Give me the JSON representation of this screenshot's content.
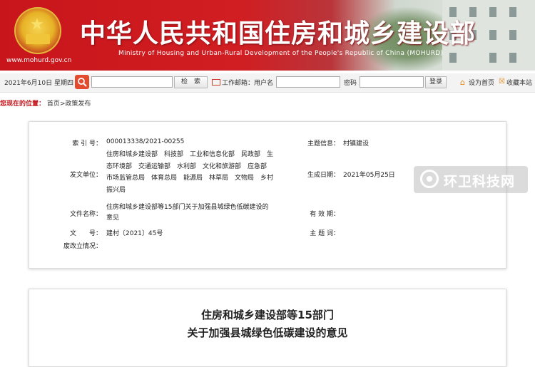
{
  "banner": {
    "title": "中华人民共和国住房和城乡建设部",
    "subtitle": "Ministry of Housing and Urban-Rural Development of the People's Republic of China (MOHURD)",
    "url": "www.mohurd.gov.cn"
  },
  "toolbar": {
    "date": "2021年6月10日 星期四",
    "search_button": "检　索",
    "mail_label": "工作邮箱：用户名",
    "password_label": "密码",
    "login_button": "登录",
    "set_home": "设为首页",
    "add_favorite": "收藏本站",
    "search_value": "",
    "username_value": "",
    "password_value": ""
  },
  "breadcrumb": {
    "location_label": "您现在的位置：",
    "path": "首页>政策发布"
  },
  "info": {
    "index_label": "索 引 号：",
    "index_value": "000013338/2021-00255",
    "topic_label": "主题信息：",
    "topic_value": "村镇建设",
    "issuer_label": "发文单位：",
    "issuer_value": "住房和城乡建设部　科技部　工业和信息化部　民政部　生态环境部　交通运输部　水利部　文化和旅游部　应急部　市场监管总局　体育总局　能源局　林草局　文物局　乡村振兴局",
    "date_label": "生成日期：",
    "date_value": "2021年05月25日",
    "docname_label": "文件名称：",
    "docname_value": "住房和城乡建设部等15部门关于加强县城绿色低碳建设的意见",
    "validity_label": "有 效 期：",
    "validity_value": "",
    "docno_label": "文　　号：",
    "docno_value": "建村〔2021〕45号",
    "keywords_label": "主 题 词：",
    "keywords_value": "",
    "revision_label": "废改立情况：",
    "revision_value": ""
  },
  "watermark": {
    "text": "环卫科技网"
  },
  "article": {
    "title_line1": "住房和城乡建设部等15部门",
    "title_line2": "关于加强县城绿色低碳建设的意见"
  },
  "colors": {
    "banner_red": "#c8151b",
    "location_red": "#c3141b",
    "search_icon_bg": "#e34b2c"
  }
}
